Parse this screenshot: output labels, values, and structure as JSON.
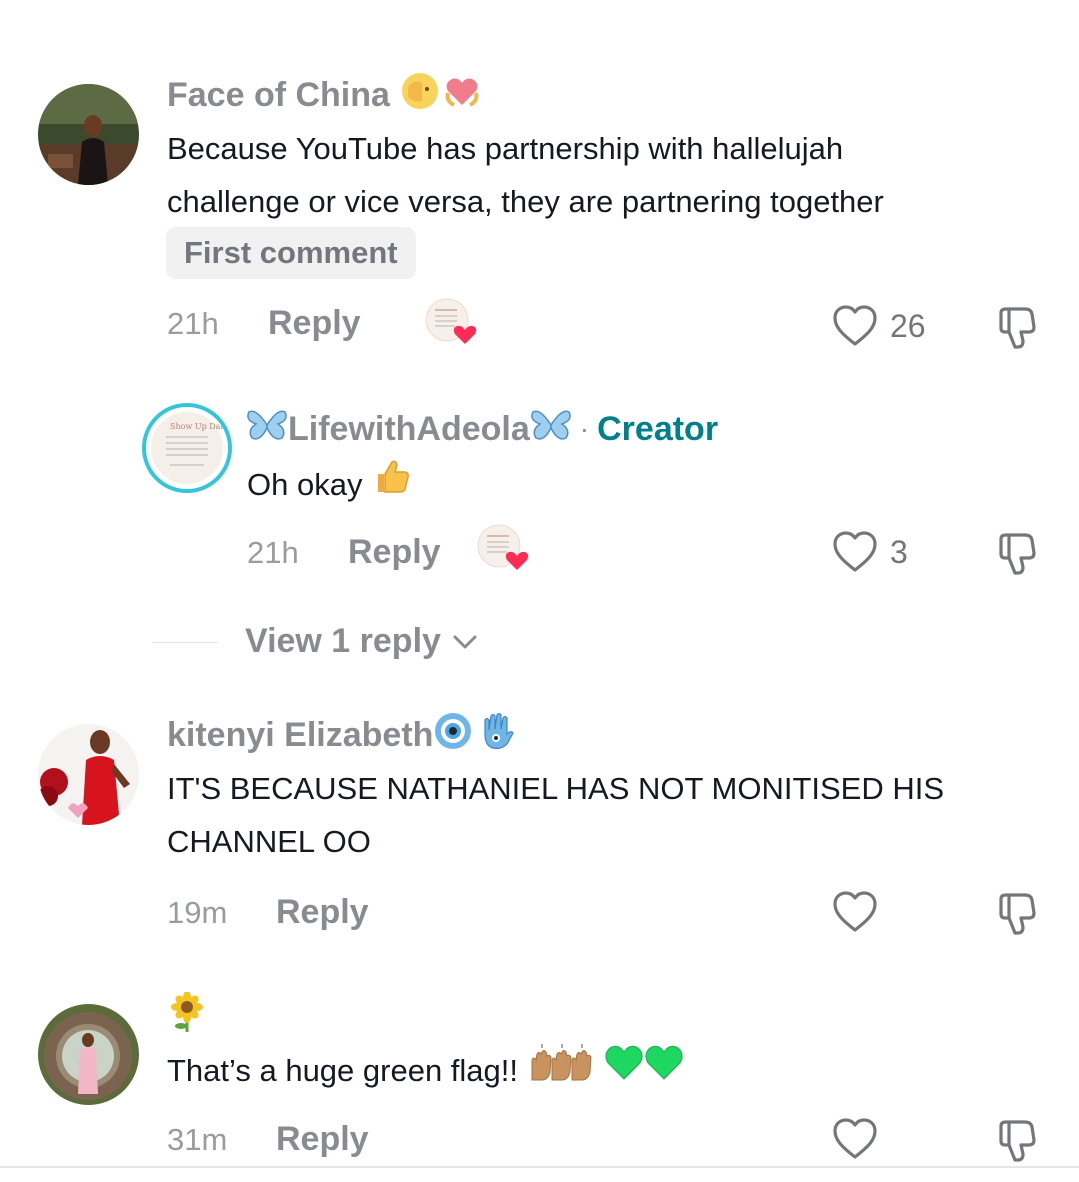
{
  "comments": [
    {
      "username": "Face of China",
      "text_lines": [
        "Because YouTube has partnership with hallelujah",
        "challenge or vice versa, they are partnering together"
      ],
      "badge": "First comment",
      "time": "21h",
      "reply_label": "Reply",
      "likes": "26"
    },
    {
      "username": "LifewithAdeola",
      "creator_label": "Creator",
      "separator": "·",
      "text": "Oh okay",
      "time": "21h",
      "reply_label": "Reply",
      "likes": "3"
    },
    {
      "username": "kitenyi Elizabeth",
      "text_lines": [
        "IT'S BECAUSE NATHANIEL HAS NOT MONITISED HIS",
        "CHANNEL OO"
      ],
      "time": "19m",
      "reply_label": "Reply",
      "likes": ""
    },
    {
      "username": "",
      "text": "That’s a huge green flag!!",
      "time": "31m",
      "reply_label": "Reply",
      "likes": ""
    }
  ],
  "view_replies_label": "View 1 reply",
  "colors": {
    "accent": "#00818a",
    "heart": "#fe2c55",
    "muted": "#8a8b91"
  },
  "icons": [
    "heart-outline-icon",
    "dislike-icon",
    "chevron-down-icon",
    "creator-liked-icon"
  ]
}
